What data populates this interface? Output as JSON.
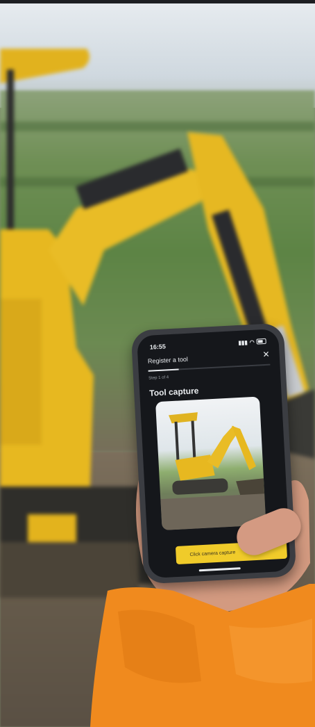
{
  "phone": {
    "status_time": "16:55",
    "dialog_title": "Register a tool",
    "step_label": "Step 1 of 4",
    "step_progress": 0.25,
    "heading": "Tool capture",
    "cta_label": "Click camera capture"
  },
  "colors": {
    "excavator_yellow": "#e7b820",
    "jacket_orange": "#f08a1e",
    "screen_dark": "#15171b",
    "cta_yellow": "#f0cb2a"
  },
  "icons": {
    "close": "close-icon",
    "signal": "signal-icon",
    "wifi": "wifi-icon",
    "battery": "battery-icon"
  }
}
